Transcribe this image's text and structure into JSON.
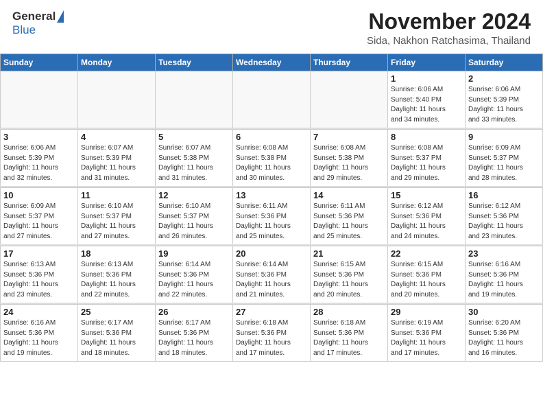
{
  "header": {
    "logo_general": "General",
    "logo_blue": "Blue",
    "month_title": "November 2024",
    "location": "Sida, Nakhon Ratchasima, Thailand"
  },
  "days_of_week": [
    "Sunday",
    "Monday",
    "Tuesday",
    "Wednesday",
    "Thursday",
    "Friday",
    "Saturday"
  ],
  "weeks": [
    [
      {
        "day": "",
        "info": ""
      },
      {
        "day": "",
        "info": ""
      },
      {
        "day": "",
        "info": ""
      },
      {
        "day": "",
        "info": ""
      },
      {
        "day": "",
        "info": ""
      },
      {
        "day": "1",
        "info": "Sunrise: 6:06 AM\nSunset: 5:40 PM\nDaylight: 11 hours\nand 34 minutes."
      },
      {
        "day": "2",
        "info": "Sunrise: 6:06 AM\nSunset: 5:39 PM\nDaylight: 11 hours\nand 33 minutes."
      }
    ],
    [
      {
        "day": "3",
        "info": "Sunrise: 6:06 AM\nSunset: 5:39 PM\nDaylight: 11 hours\nand 32 minutes."
      },
      {
        "day": "4",
        "info": "Sunrise: 6:07 AM\nSunset: 5:39 PM\nDaylight: 11 hours\nand 31 minutes."
      },
      {
        "day": "5",
        "info": "Sunrise: 6:07 AM\nSunset: 5:38 PM\nDaylight: 11 hours\nand 31 minutes."
      },
      {
        "day": "6",
        "info": "Sunrise: 6:08 AM\nSunset: 5:38 PM\nDaylight: 11 hours\nand 30 minutes."
      },
      {
        "day": "7",
        "info": "Sunrise: 6:08 AM\nSunset: 5:38 PM\nDaylight: 11 hours\nand 29 minutes."
      },
      {
        "day": "8",
        "info": "Sunrise: 6:08 AM\nSunset: 5:37 PM\nDaylight: 11 hours\nand 29 minutes."
      },
      {
        "day": "9",
        "info": "Sunrise: 6:09 AM\nSunset: 5:37 PM\nDaylight: 11 hours\nand 28 minutes."
      }
    ],
    [
      {
        "day": "10",
        "info": "Sunrise: 6:09 AM\nSunset: 5:37 PM\nDaylight: 11 hours\nand 27 minutes."
      },
      {
        "day": "11",
        "info": "Sunrise: 6:10 AM\nSunset: 5:37 PM\nDaylight: 11 hours\nand 27 minutes."
      },
      {
        "day": "12",
        "info": "Sunrise: 6:10 AM\nSunset: 5:37 PM\nDaylight: 11 hours\nand 26 minutes."
      },
      {
        "day": "13",
        "info": "Sunrise: 6:11 AM\nSunset: 5:36 PM\nDaylight: 11 hours\nand 25 minutes."
      },
      {
        "day": "14",
        "info": "Sunrise: 6:11 AM\nSunset: 5:36 PM\nDaylight: 11 hours\nand 25 minutes."
      },
      {
        "day": "15",
        "info": "Sunrise: 6:12 AM\nSunset: 5:36 PM\nDaylight: 11 hours\nand 24 minutes."
      },
      {
        "day": "16",
        "info": "Sunrise: 6:12 AM\nSunset: 5:36 PM\nDaylight: 11 hours\nand 23 minutes."
      }
    ],
    [
      {
        "day": "17",
        "info": "Sunrise: 6:13 AM\nSunset: 5:36 PM\nDaylight: 11 hours\nand 23 minutes."
      },
      {
        "day": "18",
        "info": "Sunrise: 6:13 AM\nSunset: 5:36 PM\nDaylight: 11 hours\nand 22 minutes."
      },
      {
        "day": "19",
        "info": "Sunrise: 6:14 AM\nSunset: 5:36 PM\nDaylight: 11 hours\nand 22 minutes."
      },
      {
        "day": "20",
        "info": "Sunrise: 6:14 AM\nSunset: 5:36 PM\nDaylight: 11 hours\nand 21 minutes."
      },
      {
        "day": "21",
        "info": "Sunrise: 6:15 AM\nSunset: 5:36 PM\nDaylight: 11 hours\nand 20 minutes."
      },
      {
        "day": "22",
        "info": "Sunrise: 6:15 AM\nSunset: 5:36 PM\nDaylight: 11 hours\nand 20 minutes."
      },
      {
        "day": "23",
        "info": "Sunrise: 6:16 AM\nSunset: 5:36 PM\nDaylight: 11 hours\nand 19 minutes."
      }
    ],
    [
      {
        "day": "24",
        "info": "Sunrise: 6:16 AM\nSunset: 5:36 PM\nDaylight: 11 hours\nand 19 minutes."
      },
      {
        "day": "25",
        "info": "Sunrise: 6:17 AM\nSunset: 5:36 PM\nDaylight: 11 hours\nand 18 minutes."
      },
      {
        "day": "26",
        "info": "Sunrise: 6:17 AM\nSunset: 5:36 PM\nDaylight: 11 hours\nand 18 minutes."
      },
      {
        "day": "27",
        "info": "Sunrise: 6:18 AM\nSunset: 5:36 PM\nDaylight: 11 hours\nand 17 minutes."
      },
      {
        "day": "28",
        "info": "Sunrise: 6:18 AM\nSunset: 5:36 PM\nDaylight: 11 hours\nand 17 minutes."
      },
      {
        "day": "29",
        "info": "Sunrise: 6:19 AM\nSunset: 5:36 PM\nDaylight: 11 hours\nand 17 minutes."
      },
      {
        "day": "30",
        "info": "Sunrise: 6:20 AM\nSunset: 5:36 PM\nDaylight: 11 hours\nand 16 minutes."
      }
    ]
  ]
}
